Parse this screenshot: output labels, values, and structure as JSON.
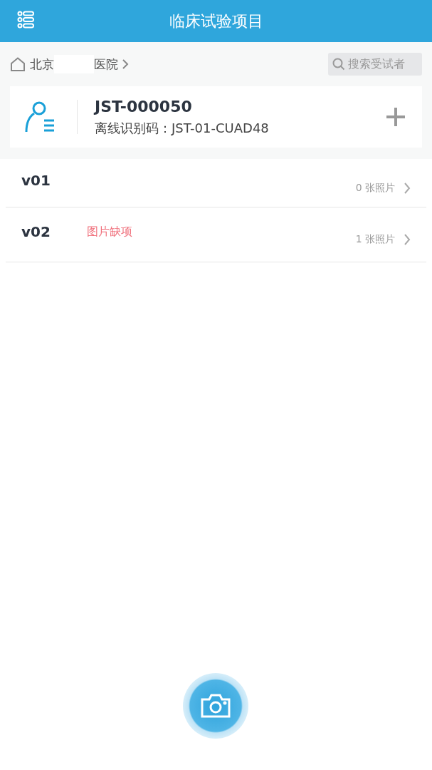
{
  "header": {
    "title": "临床试验项目"
  },
  "breadcrumb": {
    "city": "北京",
    "hospital": "医院"
  },
  "search": {
    "placeholder": "搜索受试者"
  },
  "subject": {
    "id": "JST-000050",
    "code_label": "离线识别码：",
    "code": "JST-01-CUAD48"
  },
  "visits": [
    {
      "name": "v01",
      "count": "0 张照片"
    },
    {
      "name": "v02",
      "warning": "图片缺项",
      "count": "1 张照片"
    }
  ]
}
